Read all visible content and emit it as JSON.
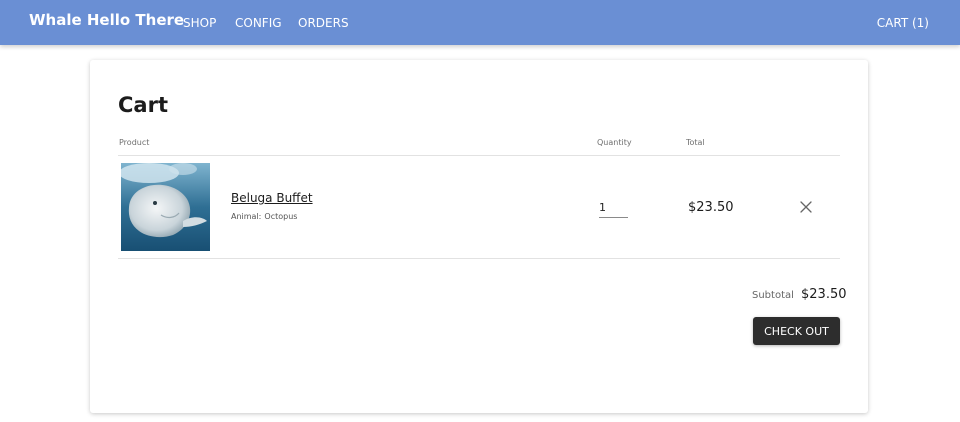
{
  "navbar": {
    "brand": "Whale Hello There",
    "links": [
      {
        "label": "SHOP"
      },
      {
        "label": "CONFIG"
      },
      {
        "label": "ORDERS"
      }
    ],
    "cart_label": "CART (1)",
    "background_color": "#6a8fd4"
  },
  "cart": {
    "title": "Cart",
    "columns": {
      "product": "Product",
      "quantity": "Quantity",
      "total": "Total"
    },
    "items": [
      {
        "name": "Beluga Buffet",
        "option_label": "Animal:",
        "option_value": "Octopus",
        "quantity": "1",
        "total": "$23.50",
        "image_icon": "beluga-whale-photo",
        "remove_icon": "close-icon"
      }
    ],
    "subtotal_label": "Subtotal",
    "subtotal_value": "$23.50",
    "checkout_label": "CHECK OUT",
    "checkout_color": "#2d2d2d"
  }
}
